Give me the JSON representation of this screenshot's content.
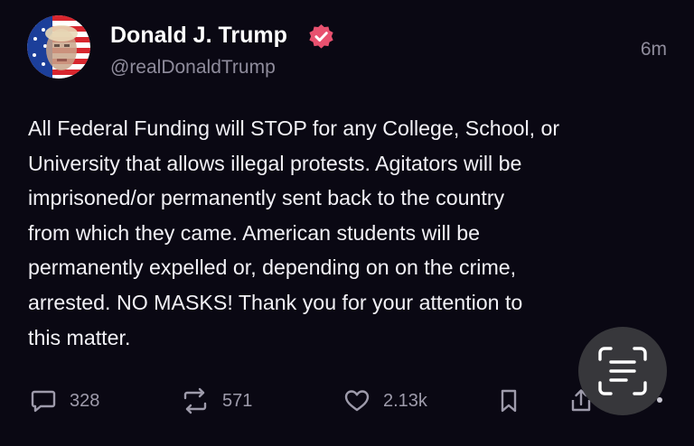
{
  "author": {
    "display_name": "Donald J. Trump",
    "handle": "@realDonaldTrump",
    "verified": true,
    "avatar": "stars-and-stripes-portrait"
  },
  "timestamp": "6m",
  "post_text": "All Federal Funding will STOP for any College, School, or\nUniversity that allows illegal protests. Agitators will be\nimprisoned/or permanently sent back to the country\nfrom which they came. American students will be\npermanently expelled or, depending on on the crime,\narrested. NO MASKS! Thank you for your attention to\nthis matter.",
  "actions": {
    "replies": "328",
    "reposts": "571",
    "likes": "2.13k"
  },
  "icons": {
    "reply": "speech-bubble-icon",
    "repost": "repost-arrows-icon",
    "like": "heart-icon",
    "bookmark": "bookmark-icon",
    "share": "share-icon",
    "scan": "text-scan-icon"
  },
  "colors": {
    "background": "#0a0813",
    "text": "#f2f1f6",
    "muted": "#8f8c9c",
    "verified_badge": "#e8516f"
  }
}
